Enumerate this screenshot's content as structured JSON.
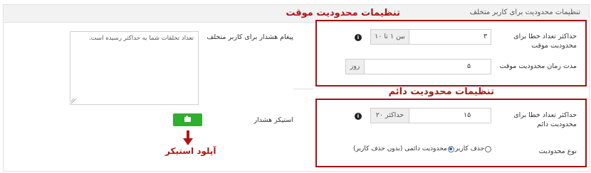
{
  "panel": {
    "title": "تنظیمات محدودیت برای کاربر متخلف"
  },
  "annotations": {
    "temporary": "تنظیمات محدودیت موقت",
    "permanent": "تنظیمات محدودیت دائم",
    "sticker_upload": "آپلود استیکر"
  },
  "temporary": {
    "max_errors_label": "حداکثر تعداد خطا برای محدودیت موقت",
    "max_errors_value": "۳",
    "max_errors_hint": "بین ۱ تا ۱۰",
    "duration_label": "مدت زمان محدودیت موقت",
    "duration_value": "۵",
    "duration_unit": "روز"
  },
  "permanent": {
    "max_errors_label": "حداکثر تعداد خطا برای محدودیت دائم",
    "max_errors_value": "۱۵",
    "max_errors_hint": "حداکثر ۲۰",
    "type_label": "نوع محدودیت",
    "options": [
      {
        "label": "حذف کاربر",
        "checked": false
      },
      {
        "label": "محدودیت دائمی (بدون حذف کاربر)",
        "checked": true
      }
    ]
  },
  "warning": {
    "message_label": "پیغام هشدار برای کاربر متخلف",
    "message_value": "تعداد تخلفات شما به حداکثر رسیده است.",
    "sticker_label": "استیکر هشدار"
  },
  "colors": {
    "accent_red": "#a31212",
    "button_green": "#2fae2f"
  },
  "icons": {
    "info": "info-icon",
    "image": "image-icon",
    "arrow": "arrow-down-icon"
  }
}
